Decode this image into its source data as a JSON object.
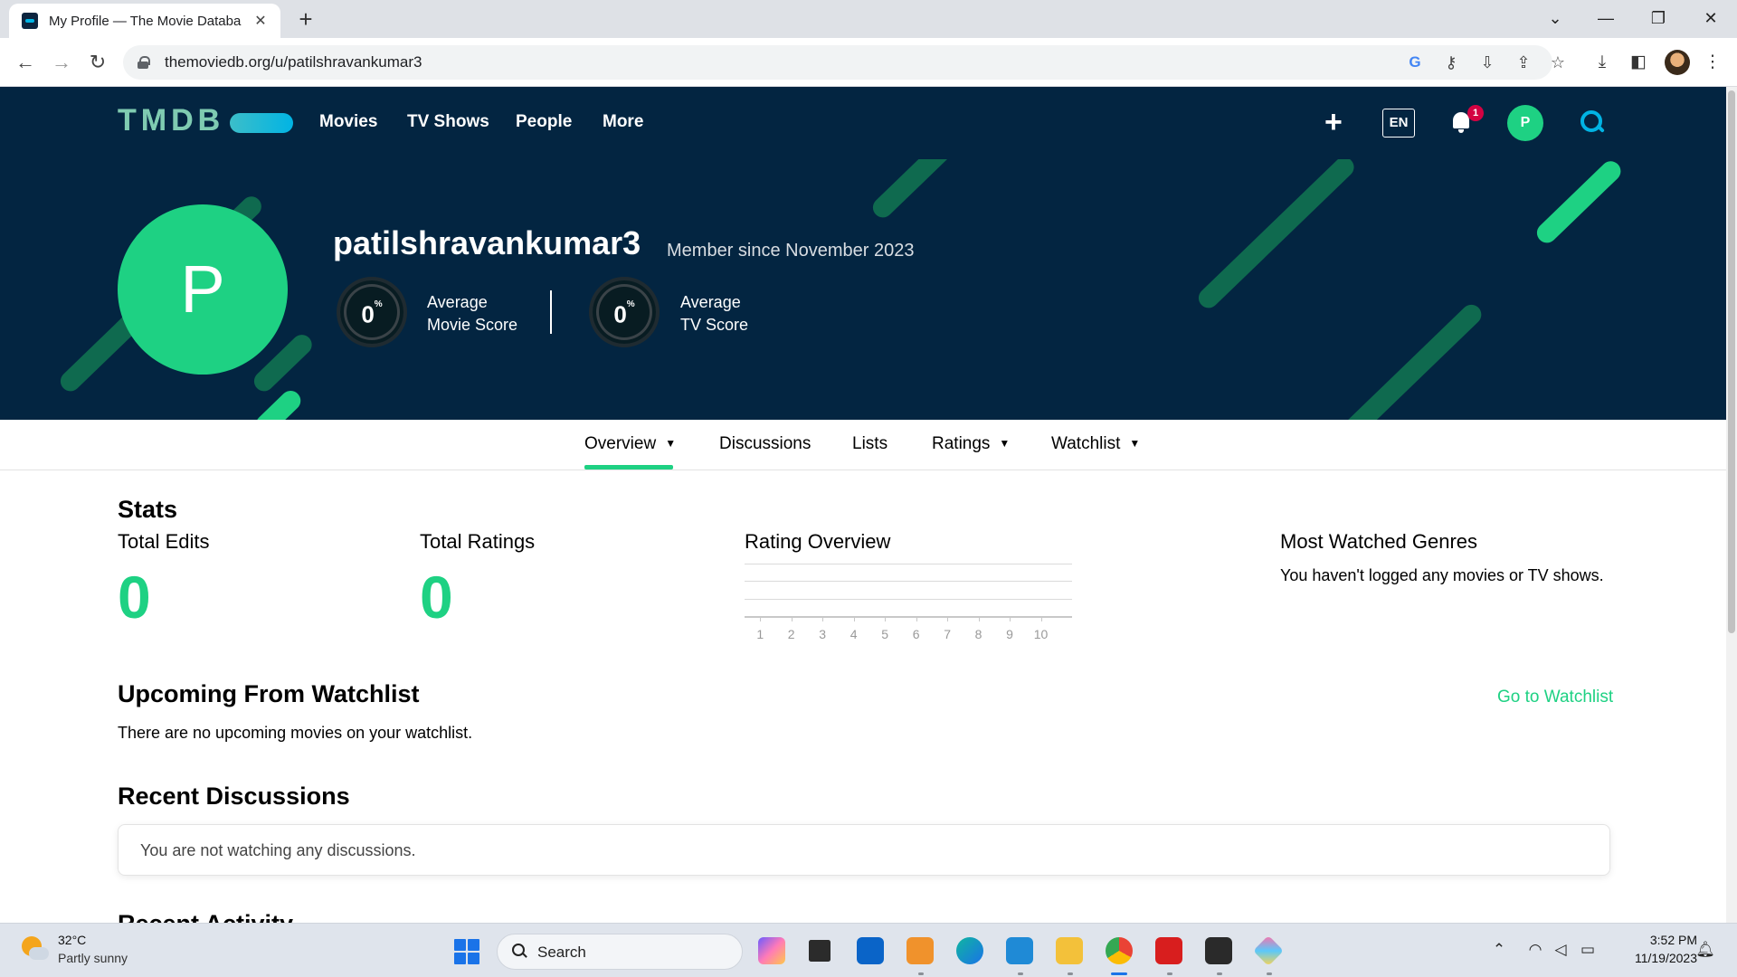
{
  "browser": {
    "tab_title": "My Profile — The Movie Databa",
    "url": "themoviedb.org/u/patilshravankumar3"
  },
  "header": {
    "logo": "TMDB",
    "nav": [
      "Movies",
      "TV Shows",
      "People",
      "More"
    ],
    "lang": "EN",
    "notif_count": "1",
    "avatar_letter": "P"
  },
  "profile": {
    "avatar_letter": "P",
    "username": "patilshravankumar3",
    "member_since": "Member since November 2023",
    "movie_score": {
      "value": "0",
      "unit": "%",
      "label_line1": "Average",
      "label_line2": "Movie Score"
    },
    "tv_score": {
      "value": "0",
      "unit": "%",
      "label_line1": "Average",
      "label_line2": "TV Score"
    }
  },
  "subnav": {
    "items": [
      "Overview",
      "Discussions",
      "Lists",
      "Ratings",
      "Watchlist"
    ],
    "active": "Overview"
  },
  "stats": {
    "title": "Stats",
    "total_edits_label": "Total Edits",
    "total_edits_value": "0",
    "total_ratings_label": "Total Ratings",
    "total_ratings_value": "0",
    "rating_overview_title": "Rating Overview",
    "rating_ticks": [
      "1",
      "2",
      "3",
      "4",
      "5",
      "6",
      "7",
      "8",
      "9",
      "10"
    ],
    "genres_title": "Most Watched Genres",
    "genres_empty": "You haven't logged any movies or TV shows."
  },
  "upcoming": {
    "title": "Upcoming From Watchlist",
    "link": "Go to Watchlist",
    "empty": "There are no upcoming movies on your watchlist."
  },
  "discussions": {
    "title": "Recent Discussions",
    "empty": "You are not watching any discussions."
  },
  "next_section_title": "Recent Activity",
  "taskbar": {
    "temp": "32°C",
    "weather": "Partly sunny",
    "search_label": "Search",
    "time": "3:52 PM",
    "date": "11/19/2023"
  },
  "colors": {
    "tmdb_navy": "#032541",
    "tmdb_green": "#1ed183",
    "tmdb_blue": "#01b4e4",
    "badge_red": "#d40242"
  }
}
